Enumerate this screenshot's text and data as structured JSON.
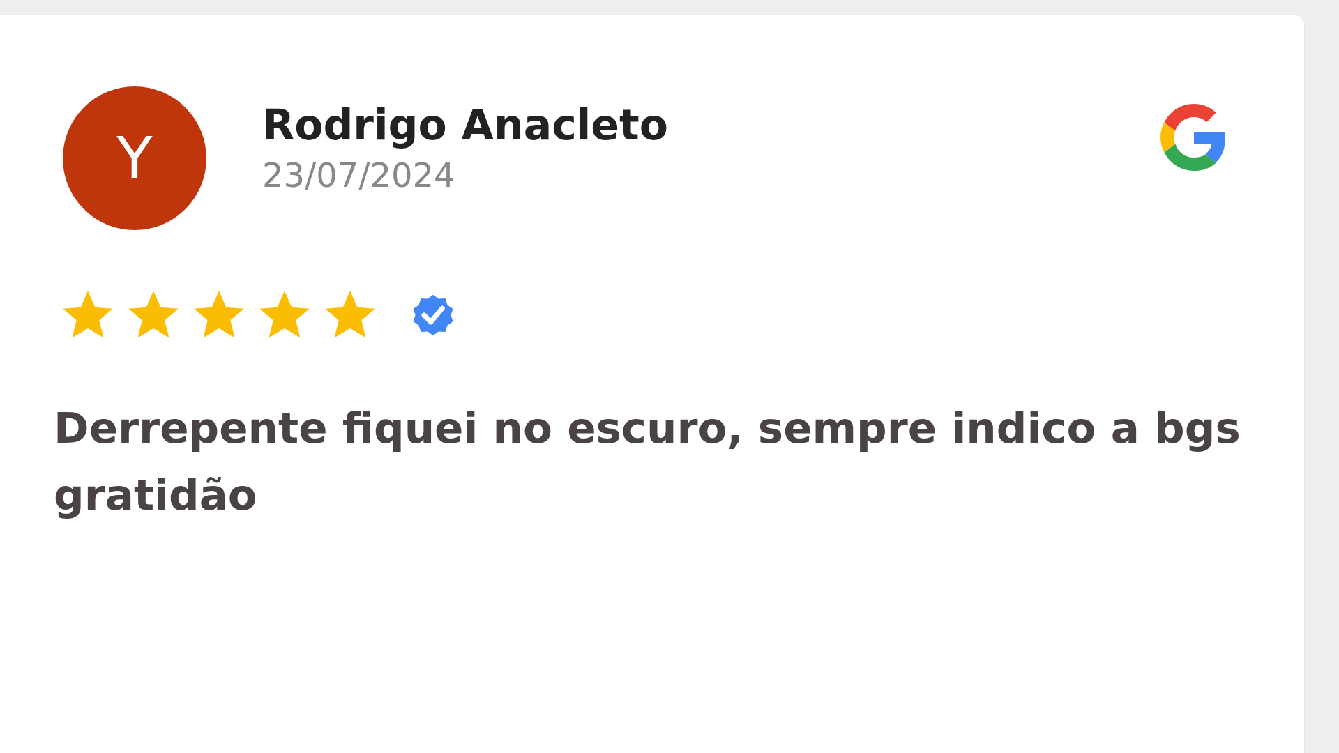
{
  "review": {
    "avatar_letter": "Y",
    "name": "Rodrigo Anacleto",
    "date": "23/07/2024",
    "stars": 5,
    "verified": true,
    "text": "Derrepente fiquei no escuro, sempre indico a bgs gratidão"
  }
}
